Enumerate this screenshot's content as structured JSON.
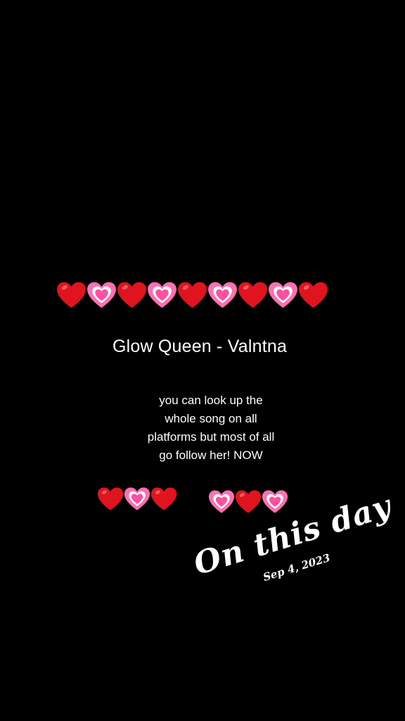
{
  "story": {
    "song_title": "Glow Queen - Valntna",
    "message_lines": [
      "you can look up the",
      "whole song on all",
      "platforms  but most of all",
      "go follow her! NOW"
    ],
    "memory_label": "On this day",
    "memory_date": "Sep 4, 2023"
  },
  "decor": {
    "top_row": [
      "red-heart",
      "pink-heart",
      "red-heart",
      "pink-heart",
      "red-heart",
      "pink-heart",
      "red-heart",
      "pink-heart",
      "red-heart"
    ],
    "bottom_left_row": [
      "red-heart",
      "pink-heart",
      "red-heart"
    ],
    "bottom_right_row": [
      "pink-heart",
      "red-heart",
      "pink-heart"
    ]
  },
  "colors": {
    "background": "#000000",
    "text": "#ffffff",
    "red_heart": "#e0141e",
    "pink_heart_outer": "#ff6fb1",
    "pink_heart_inner": "#ffffff"
  }
}
